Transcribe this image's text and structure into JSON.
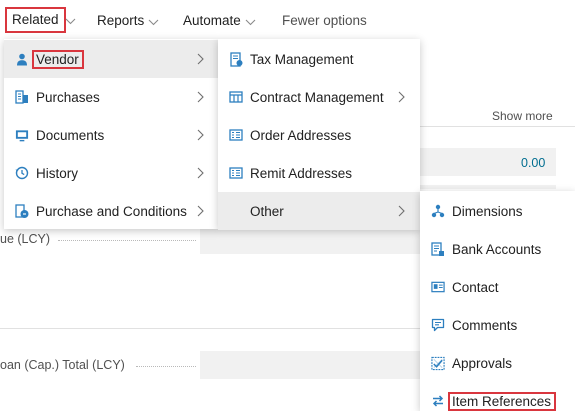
{
  "actionbar": {
    "related": "Related",
    "reports": "Reports",
    "automate": "Automate",
    "fewer": "Fewer options"
  },
  "background": {
    "show_more": "Show more",
    "value_1": "0.00",
    "field_label_1": "ue (LCY)",
    "field_label_2": "oan (Cap.) Total (LCY)"
  },
  "menu_related": {
    "items": [
      {
        "label": "Vendor",
        "icon": "person-icon"
      },
      {
        "label": "Purchases",
        "icon": "purchases-icon"
      },
      {
        "label": "Documents",
        "icon": "documents-icon"
      },
      {
        "label": "History",
        "icon": "history-icon"
      },
      {
        "label": "Purchase and Conditions",
        "icon": "purchase-conditions-icon"
      }
    ]
  },
  "menu_vendor": {
    "items": [
      {
        "label": "Tax Management",
        "icon": "tax-icon"
      },
      {
        "label": "Contract Management",
        "icon": "contract-icon"
      },
      {
        "label": "Order Addresses",
        "icon": "address-list-icon"
      },
      {
        "label": "Remit Addresses",
        "icon": "address-list-icon"
      },
      {
        "label": "Other"
      }
    ]
  },
  "menu_other": {
    "items": [
      {
        "label": "Dimensions",
        "icon": "dimensions-icon"
      },
      {
        "label": "Bank Accounts",
        "icon": "bank-icon"
      },
      {
        "label": "Contact",
        "icon": "contact-card-icon"
      },
      {
        "label": "Comments",
        "icon": "comment-icon"
      },
      {
        "label": "Approvals",
        "icon": "approvals-icon"
      },
      {
        "label": "Item References",
        "icon": "swap-arrows-icon"
      }
    ]
  },
  "colors": {
    "accent": "#2d7fbf",
    "highlight": "#d9363e",
    "hover": "#ececec"
  }
}
